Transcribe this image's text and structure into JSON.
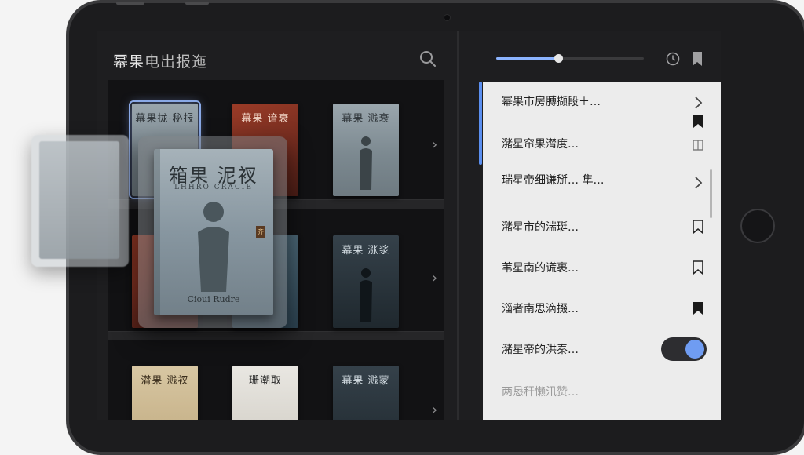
{
  "app": {
    "title_main": "幂果",
    "title_rest": "电岀报迤"
  },
  "shelf": {
    "row1": [
      {
        "title": "幕果拢·秘报",
        "style": "b-sky",
        "selected": true
      },
      {
        "title": "幕果 谙衰",
        "style": "b-red"
      },
      {
        "title": "幕果 溅衰",
        "style": "b-sky"
      }
    ],
    "row2": [
      {
        "title": "",
        "style": "b-red"
      },
      {
        "title": "",
        "style": "b-sea"
      },
      {
        "title": "幕果 涨浆",
        "style": "b-dark"
      }
    ],
    "row3": [
      {
        "title": "潸果 溅衩",
        "style": "b-cream"
      },
      {
        "title": "珊潮取",
        "style": "b-white"
      },
      {
        "title": "幕果 溅蒙",
        "style": "b-dark"
      }
    ]
  },
  "drag_book": {
    "title": "箱果 泥衩",
    "subtitle": "LHHRO CRACIE",
    "author": "Cioui Rudre",
    "seal": "齐"
  },
  "reader": {
    "progress": 0.42
  },
  "toc": [
    {
      "label": "幂果市房膊撷段＋…",
      "icon": "chevron-right"
    },
    {
      "label": "潴星帘果潸度…",
      "icon": "bookmark-filled"
    },
    {
      "label": "瑞星帝细谦掰… 隼…",
      "icon": "chevron-right"
    },
    {
      "label": "潴星市的湍珽…",
      "icon": "bookmark-outline"
    },
    {
      "label": "苇星南的谎裹…",
      "icon": "bookmark-outline"
    },
    {
      "label": "淄者南思滴掇…",
      "icon": "bookmark-filled"
    },
    {
      "label": "潴星帝的洪秦…",
      "icon": "chevron-right"
    },
    {
      "label": "两恳秆懒汛赞…",
      "icon": "toggle"
    }
  ],
  "toggle_on": true,
  "colors": {
    "accent": "#5b8ff0",
    "slider": "#8cb4ff",
    "toggle_knob": "#6f9cf2"
  }
}
